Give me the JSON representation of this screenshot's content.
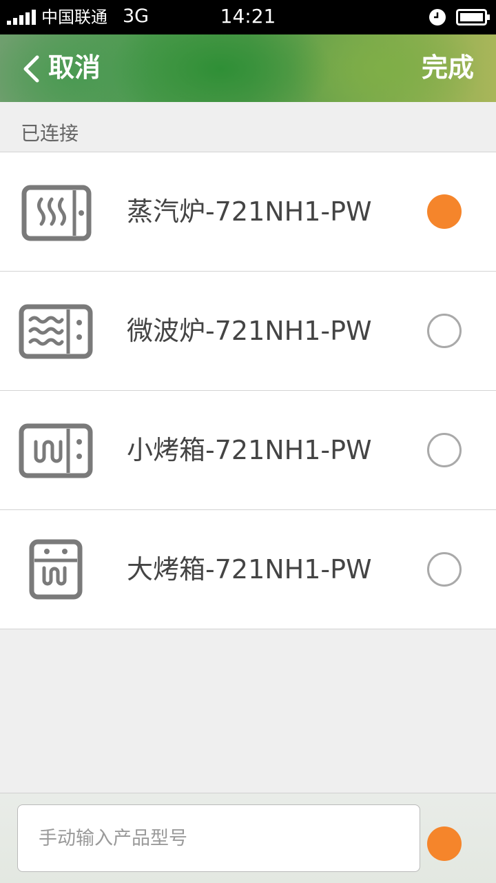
{
  "status_bar": {
    "carrier": "中国联通",
    "network": "3G",
    "time": "14:21",
    "icons": [
      "signal-icon",
      "alarm-icon",
      "battery-icon"
    ]
  },
  "header": {
    "back_icon": "chevron-left-icon",
    "cancel_label": "取消",
    "done_label": "完成"
  },
  "section": {
    "connected_label": "已连接"
  },
  "devices": [
    {
      "name": "蒸汽炉-721NH1-PW",
      "icon": "steam-oven-icon",
      "selected": true
    },
    {
      "name": "微波炉-721NH1-PW",
      "icon": "microwave-icon",
      "selected": false
    },
    {
      "name": "小烤箱-721NH1-PW",
      "icon": "small-oven-icon",
      "selected": false
    },
    {
      "name": "大烤箱-721NH1-PW",
      "icon": "large-oven-icon",
      "selected": false
    }
  ],
  "bottom_bar": {
    "model_input_placeholder": "手动输入产品型号",
    "model_input_value": ""
  },
  "colors": {
    "accent": "#f5852b",
    "icon_gray": "#7a7a7a",
    "radio_border": "#a9a9a9",
    "text_dark": "#444444",
    "header_green": "#4c9a4e"
  }
}
